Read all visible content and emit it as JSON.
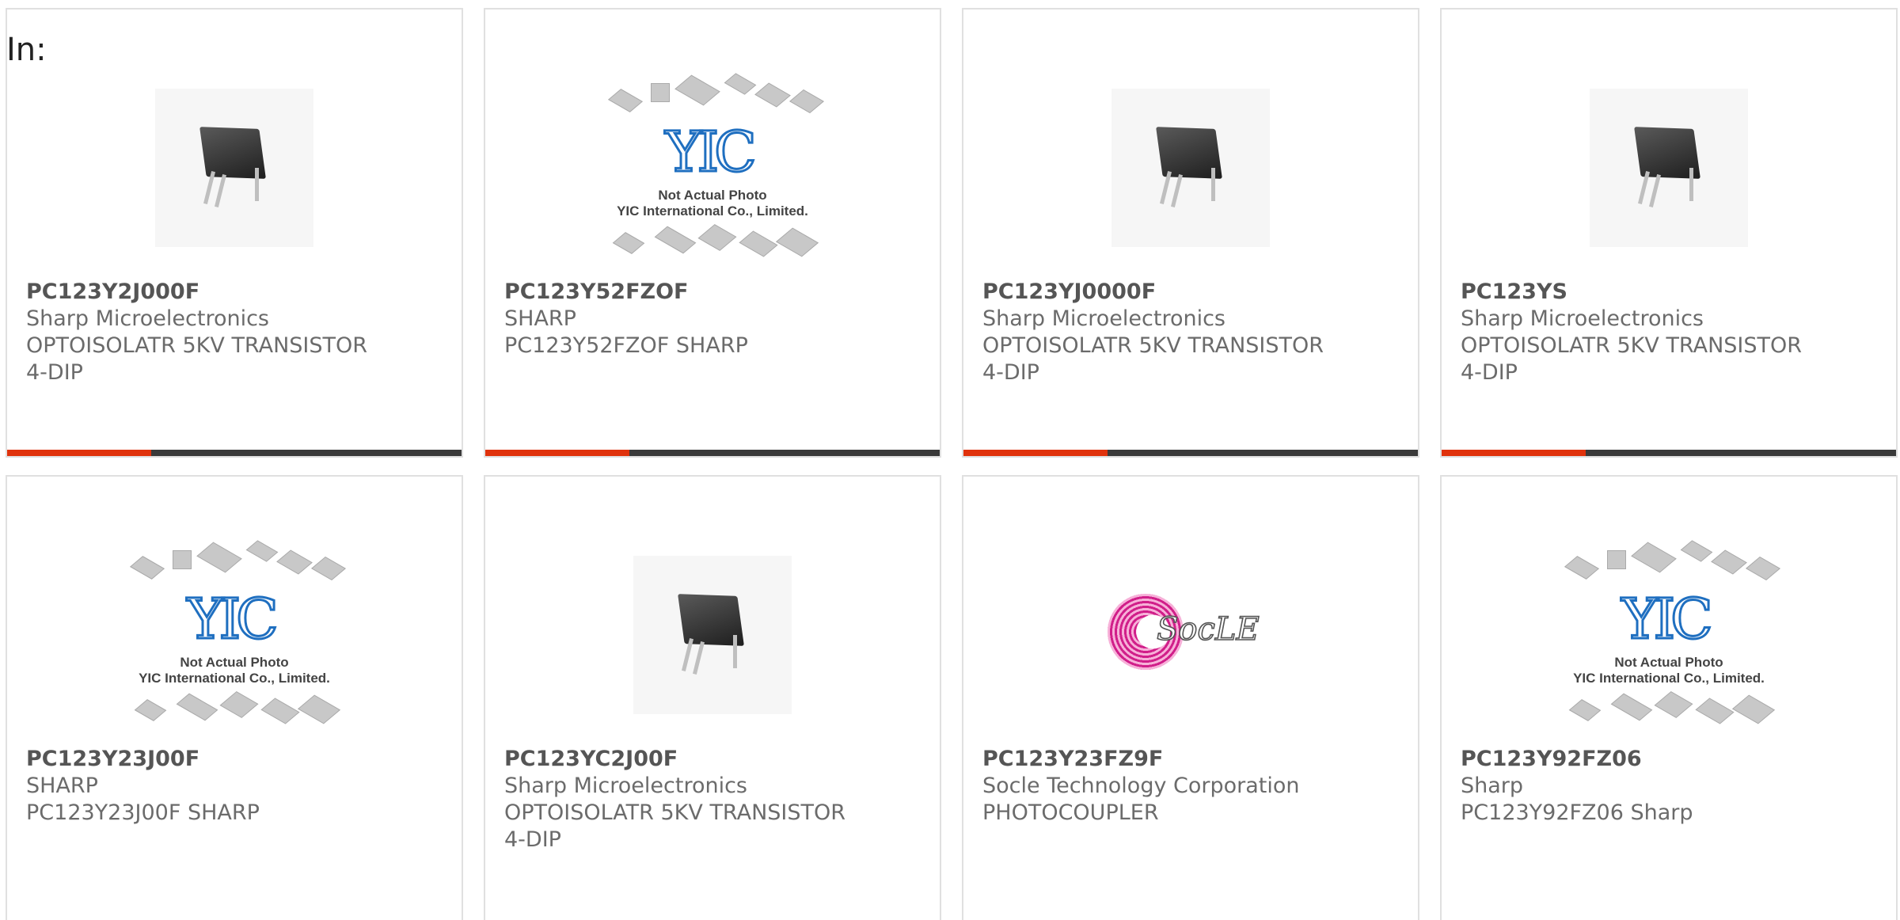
{
  "heading": "In:",
  "cards": [
    {
      "part_number": "PC123Y2J000F",
      "manufacturer": "Sharp Microelectronics",
      "description": "OPTOISOLATR 5KV TRANSISTOR",
      "package": "4-DIP",
      "image": "dip-chip-photo"
    },
    {
      "part_number": "PC123Y52FZOF",
      "manufacturer": "SHARP",
      "description": "PC123Y52FZOF SHARP",
      "package": "",
      "image": "yic-placeholder"
    },
    {
      "part_number": "PC123YJ0000F",
      "manufacturer": "Sharp Microelectronics",
      "description": "OPTOISOLATR 5KV TRANSISTOR",
      "package": "4-DIP",
      "image": "dip-chip-photo"
    },
    {
      "part_number": "PC123YS",
      "manufacturer": "Sharp Microelectronics",
      "description": "OPTOISOLATR 5KV TRANSISTOR",
      "package": "4-DIP",
      "image": "dip-chip-photo"
    },
    {
      "part_number": "PC123Y23J00F",
      "manufacturer": "SHARP",
      "description": "PC123Y23J00F SHARP",
      "package": "",
      "image": "yic-placeholder"
    },
    {
      "part_number": "PC123YC2J00F",
      "manufacturer": "Sharp Microelectronics",
      "description": "OPTOISOLATR 5KV TRANSISTOR",
      "package": "4-DIP",
      "image": "dip-chip-photo"
    },
    {
      "part_number": "PC123Y23FZ9F",
      "manufacturer": "Socle Technology Corporation",
      "description": "PHOTOCOUPLER",
      "package": "",
      "image": "socle-logo"
    },
    {
      "part_number": "PC123Y92FZ06",
      "manufacturer": "Sharp",
      "description": "PC123Y92FZ06 Sharp",
      "package": "",
      "image": "yic-placeholder"
    }
  ],
  "yic_placeholder": {
    "logo_text": "YIC",
    "caption_line1": "Not Actual Photo",
    "caption_line2": "YIC International Co., Limited."
  },
  "socle_logo": {
    "text": "SocLE"
  },
  "colors": {
    "accent": "#e0320c",
    "bar": "#3a3a3a",
    "text": "#6b6b6b",
    "yic_blue": "#1f6fc0",
    "socle_pink": "#d11f8a"
  }
}
